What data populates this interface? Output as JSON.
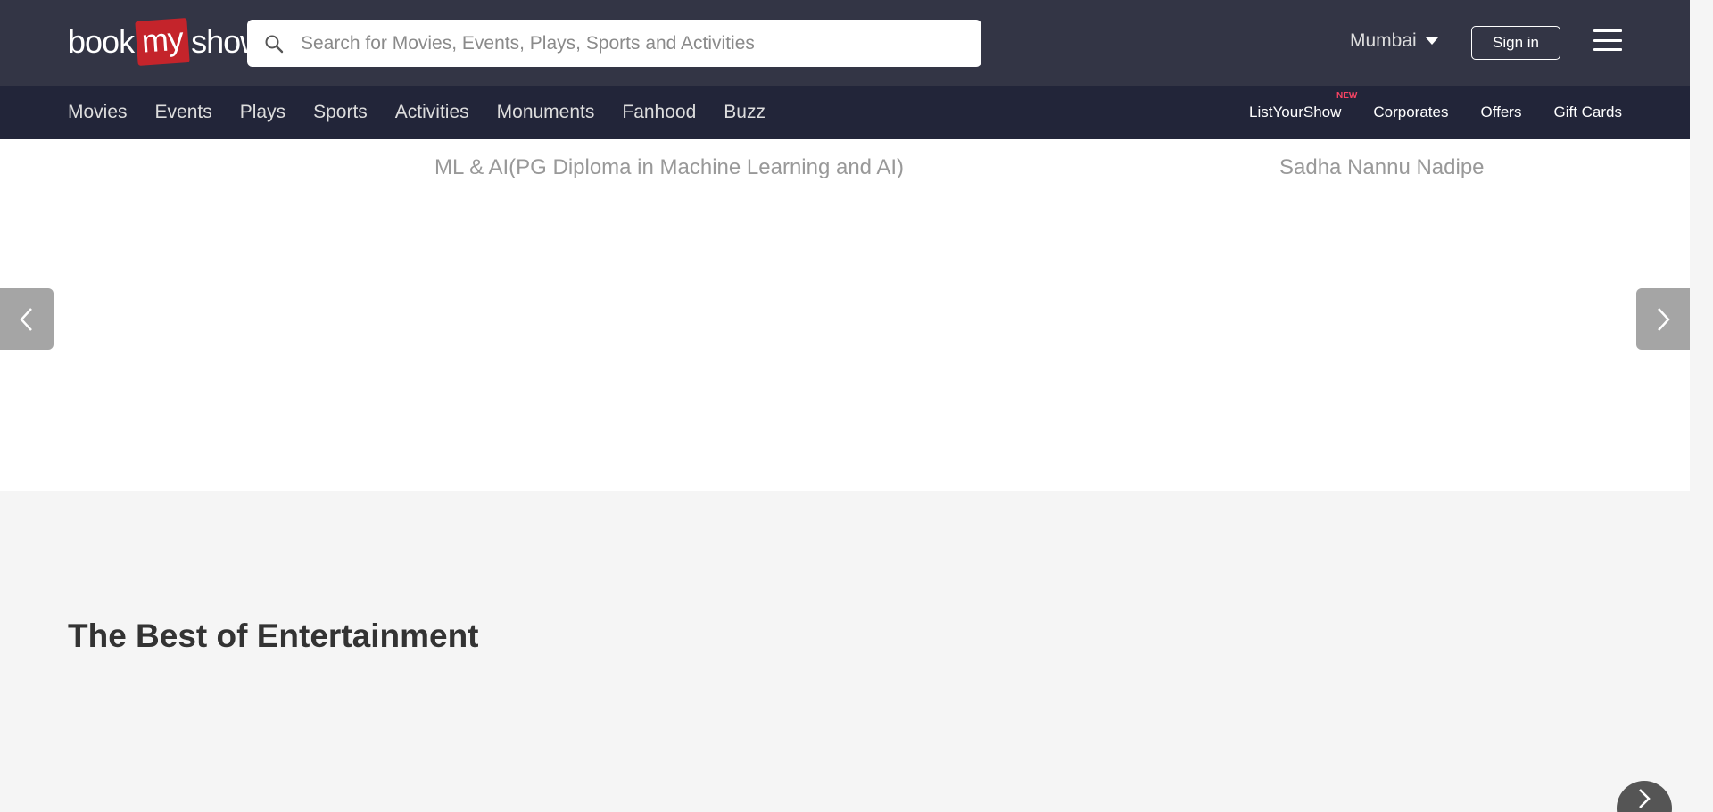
{
  "header": {
    "logo": {
      "part1": "book",
      "part2": "my",
      "part3": "show"
    },
    "search_placeholder": "Search for Movies, Events, Plays, Sports and Activities",
    "city": "Mumbai",
    "signin_label": "Sign in"
  },
  "nav": {
    "left": [
      "Movies",
      "Events",
      "Plays",
      "Sports",
      "Activities",
      "Monuments",
      "Fanhood",
      "Buzz"
    ],
    "right": [
      "ListYourShow",
      "Corporates",
      "Offers",
      "Gift Cards"
    ],
    "new_badge": "NEW"
  },
  "carousel": {
    "slides": [
      "ML & AI(PG Diploma in Machine Learning and AI)",
      "Sadha Nannu Nadipe"
    ]
  },
  "section": {
    "title": "The Best of Entertainment"
  },
  "colors": {
    "header_bg": "#333545",
    "nav_bg": "#222539",
    "accent": "#f84464"
  }
}
